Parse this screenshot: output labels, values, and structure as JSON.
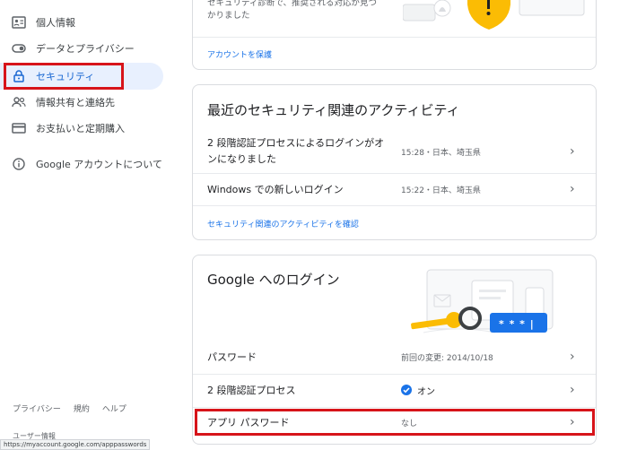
{
  "sidebar": {
    "items": [
      {
        "label": "個人情報",
        "icon": "person-card-icon"
      },
      {
        "label": "データとプライバシー",
        "icon": "toggle-icon"
      },
      {
        "label": "セキュリティ",
        "icon": "lock-icon"
      },
      {
        "label": "情報共有と連絡先",
        "icon": "people-icon"
      },
      {
        "label": "お支払いと定期購入",
        "icon": "credit-card-icon"
      },
      {
        "label": "Google アカウントについて",
        "icon": "info-icon"
      }
    ],
    "footer": {
      "privacy": "プライバシー",
      "terms": "規約",
      "help": "ヘルプ"
    },
    "user_info": "ユーザー情報"
  },
  "status_bar": {
    "url": "https://myaccount.google.com/apppasswords"
  },
  "card_top": {
    "text": "セキュリティ診断で、推奨される対応が見つかりました",
    "link": "アカウントを保護"
  },
  "activity": {
    "title": "最近のセキュリティ関連のアクティビティ",
    "rows": [
      {
        "label": "2 段階認証プロセスによるログインがオンになりました",
        "time": "15:28・日本、埼玉県"
      },
      {
        "label": "Windows での新しいログイン",
        "time": "15:22・日本、埼玉県"
      }
    ],
    "link": "セキュリティ関連のアクティビティを確認"
  },
  "signin": {
    "title": "Google へのログイン",
    "password_mask": "* * * |",
    "rows": [
      {
        "label": "パスワード",
        "value": "前回の変更: 2014/10/18"
      },
      {
        "label": "2 段階認証プロセス",
        "value": "オン"
      },
      {
        "label": "アプリ パスワード",
        "value": "なし"
      }
    ]
  },
  "colors": {
    "accent": "#1a73e8",
    "active_bg": "#e8f0fe",
    "highlight": "#d7141a",
    "shield": "#fbbc04",
    "key": "#fbbc04"
  }
}
